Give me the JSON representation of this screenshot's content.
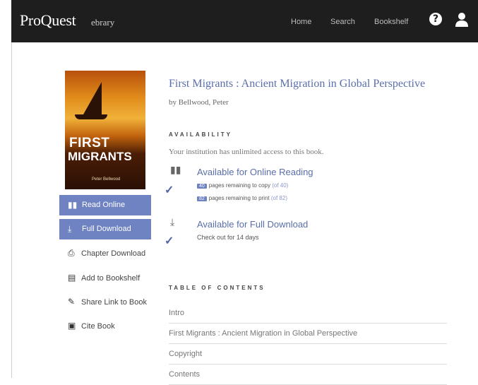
{
  "header": {
    "brand": "ProQuest",
    "brand_sub": "ebrary",
    "nav": [
      "Home",
      "Search",
      "Bookshelf"
    ],
    "background_color": "#1e1e1e"
  },
  "book": {
    "title": "First Migrants : Ancient Migration in Global Perspective",
    "author": "by Bellwood, Peter",
    "cover": {
      "title_line1": "FIRST",
      "title_line2": "MIGRANTS",
      "author": "Peter Bellwood"
    }
  },
  "buttons": {
    "read_online": "Read Online",
    "full_download": "Full Download"
  },
  "actions": {
    "chapter_download": "Chapter Download",
    "add_to_bookshelf": "Add to Bookshelf",
    "share_link": "Share Link to Book",
    "cite_book": "Cite Book"
  },
  "availability": {
    "heading": "AVAILABILITY",
    "access_text": "Your institution has unlimited access to this book.",
    "online": {
      "title": "Available for Online Reading",
      "copy_count": "40",
      "copy_text": "pages remaining to copy",
      "copy_total": "(of 40)",
      "print_count": "82",
      "print_text": "pages remaining to print",
      "print_total": "(of 82)"
    },
    "download": {
      "title": "Available for Full Download",
      "checkout": "Check out for 14 days"
    }
  },
  "toc": {
    "heading": "TABLE OF CONTENTS",
    "items": [
      "Intro",
      "First Migrants : Ancient Migration in Global Perspective",
      "Copyright",
      "Contents"
    ]
  },
  "colors": {
    "accent": "#6f82c1",
    "link": "#5a6eaa"
  }
}
